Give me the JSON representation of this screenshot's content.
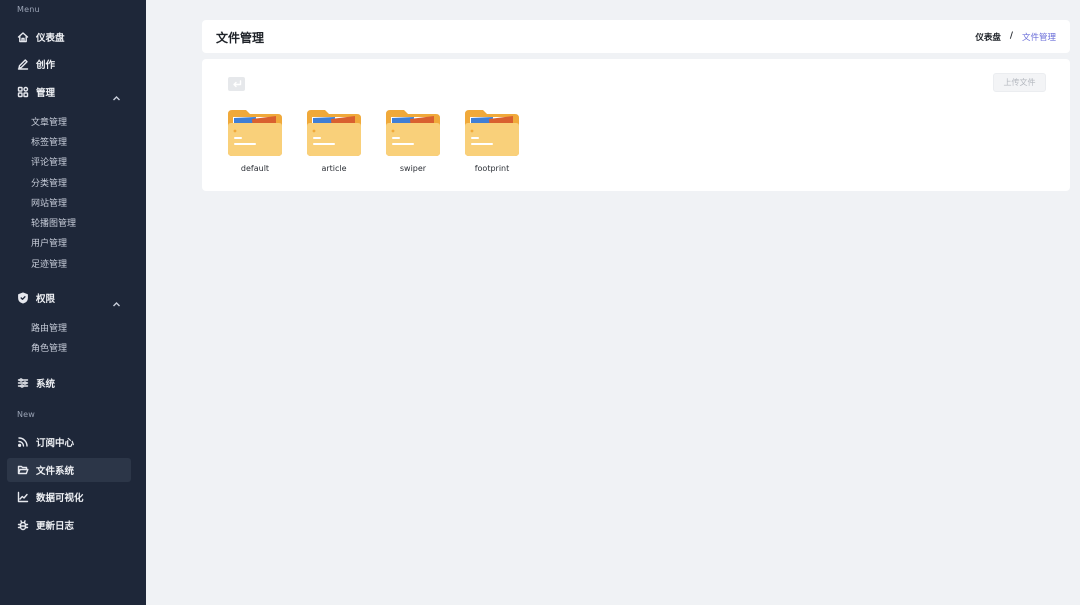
{
  "sidebar": {
    "menu_label": "Menu",
    "new_label": "New",
    "items": {
      "dashboard": "仪表盘",
      "create": "创作",
      "manage": "管理",
      "permissions": "权限",
      "system": "系统",
      "subscription": "订阅中心",
      "filesystem": "文件系统",
      "dataviz": "数据可视化",
      "changelog": "更新日志"
    },
    "manage_sub": [
      "文章管理",
      "标签管理",
      "评论管理",
      "分类管理",
      "网站管理",
      "轮播图管理",
      "用户管理",
      "足迹管理"
    ],
    "permission_sub": [
      "路由管理",
      "角色管理"
    ],
    "active_item": "文件系统"
  },
  "header": {
    "title": "文件管理",
    "breadcrumb": {
      "home": "仪表盘",
      "separator": "/",
      "current": "文件管理"
    }
  },
  "main": {
    "upload_label": "上传文件",
    "folders": [
      "default",
      "article",
      "swiper",
      "footprint"
    ]
  },
  "colors": {
    "sidebar_bg": "#1e2739",
    "active_bg": "#2c3648",
    "accent": "#6b6fd9",
    "folder_back": "#f0a93a",
    "folder_front": "#f9d07a"
  }
}
